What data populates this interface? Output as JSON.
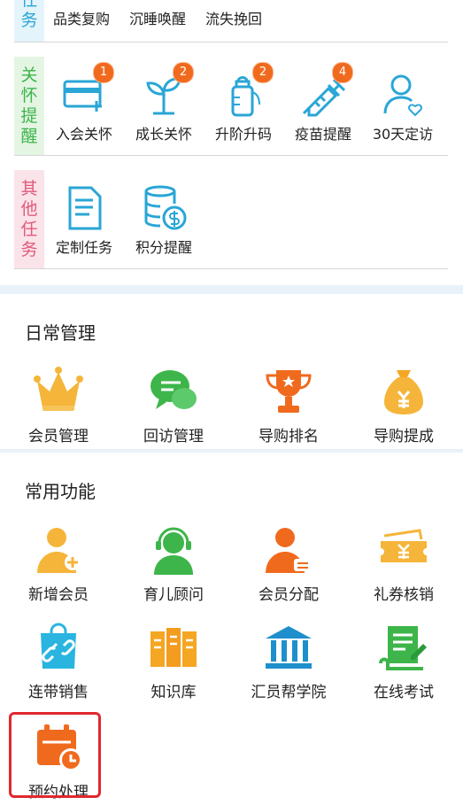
{
  "task_groups": [
    {
      "id": "top",
      "tag": "任务",
      "items": [
        "品类复购",
        "沉睡唤醒",
        "流失挽回"
      ]
    },
    {
      "id": "care",
      "tag": "关怀提醒",
      "items": [
        {
          "label": "入会关怀",
          "icon": "card-add-icon",
          "badge": "1"
        },
        {
          "label": "成长关怀",
          "icon": "sprout-icon",
          "badge": "2"
        },
        {
          "label": "升阶升码",
          "icon": "milk-bottle-icon",
          "badge": "2"
        },
        {
          "label": "疫苗提醒",
          "icon": "syringe-icon",
          "badge": "4"
        },
        {
          "label": "30天定访",
          "icon": "person-heart-icon",
          "badge": ""
        }
      ]
    },
    {
      "id": "other",
      "tag": "其他任务",
      "items": [
        {
          "label": "定制任务",
          "icon": "document-icon"
        },
        {
          "label": "积分提醒",
          "icon": "coins-icon"
        }
      ]
    }
  ],
  "daily": {
    "title": "日常管理",
    "items": [
      {
        "label": "会员管理",
        "icon": "crown-icon"
      },
      {
        "label": "回访管理",
        "icon": "chat-bubbles-icon"
      },
      {
        "label": "导购排名",
        "icon": "trophy-icon"
      },
      {
        "label": "导购提成",
        "icon": "money-bag-icon"
      }
    ]
  },
  "common": {
    "title": "常用功能",
    "items": [
      {
        "label": "新增会员",
        "icon": "add-member-icon"
      },
      {
        "label": "育儿顾问",
        "icon": "headset-advisor-icon"
      },
      {
        "label": "会员分配",
        "icon": "member-assign-icon"
      },
      {
        "label": "礼券核销",
        "icon": "coupon-icon"
      },
      {
        "label": "连带销售",
        "icon": "shopping-bag-link-icon"
      },
      {
        "label": "知识库",
        "icon": "knowledge-base-icon"
      },
      {
        "label": "汇员帮学院",
        "icon": "academy-icon"
      },
      {
        "label": "在线考试",
        "icon": "online-exam-icon"
      },
      {
        "label": "预约处理",
        "icon": "calendar-clock-icon"
      }
    ]
  },
  "colors": {
    "blue": "#29a6d6",
    "green": "#3db54a",
    "pink": "#e05a7a",
    "orange": "#f06a1e",
    "highlight": "#e0282e"
  }
}
